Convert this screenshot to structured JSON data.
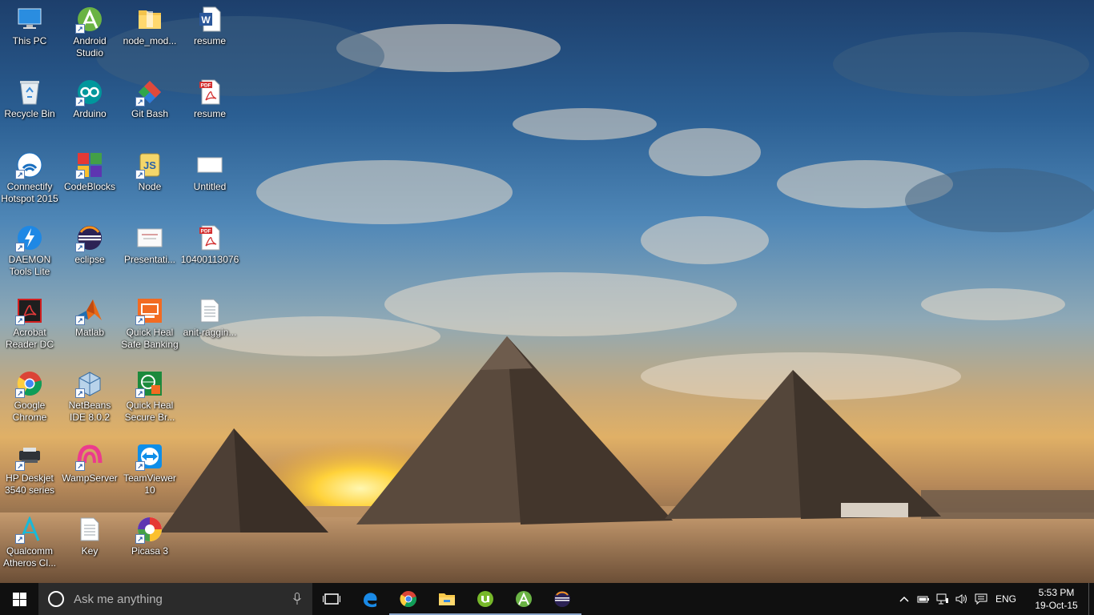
{
  "desktop": {
    "icons": [
      {
        "label": "This PC",
        "icon": "computer-icon",
        "shortcut": false
      },
      {
        "label": "Recycle Bin",
        "icon": "recycle-bin-icon",
        "shortcut": false
      },
      {
        "label": "Connectify Hotspot 2015",
        "icon": "connectify-icon",
        "shortcut": true
      },
      {
        "label": "DAEMON Tools Lite",
        "icon": "daemon-tools-icon",
        "shortcut": true
      },
      {
        "label": "Acrobat Reader DC",
        "icon": "acrobat-icon",
        "shortcut": true
      },
      {
        "label": "Google Chrome",
        "icon": "chrome-icon",
        "shortcut": true
      },
      {
        "label": "HP Deskjet 3540 series",
        "icon": "printer-icon",
        "shortcut": true
      },
      {
        "label": "Qualcomm Atheros Cl...",
        "icon": "qualcomm-icon",
        "shortcut": true
      },
      {
        "label": "Android Studio",
        "icon": "android-studio-icon",
        "shortcut": true
      },
      {
        "label": "Arduino",
        "icon": "arduino-icon",
        "shortcut": true
      },
      {
        "label": "CodeBlocks",
        "icon": "codeblocks-icon",
        "shortcut": true
      },
      {
        "label": "eclipse",
        "icon": "eclipse-icon",
        "shortcut": true
      },
      {
        "label": "Matlab",
        "icon": "matlab-icon",
        "shortcut": true
      },
      {
        "label": "NetBeans IDE 8.0.2",
        "icon": "netbeans-icon",
        "shortcut": true
      },
      {
        "label": "WampServer",
        "icon": "wampserver-icon",
        "shortcut": true
      },
      {
        "label": "Key",
        "icon": "text-file-icon",
        "shortcut": false
      },
      {
        "label": "node_mod...",
        "icon": "folder-icon",
        "shortcut": false
      },
      {
        "label": "Git Bash",
        "icon": "git-bash-icon",
        "shortcut": true
      },
      {
        "label": "Node",
        "icon": "nodejs-icon",
        "shortcut": true
      },
      {
        "label": "Presentati...",
        "icon": "presentation-icon",
        "shortcut": false
      },
      {
        "label": "Quick Heal Safe Banking",
        "icon": "quickheal-banking-icon",
        "shortcut": true
      },
      {
        "label": "Quick Heal Secure Br...",
        "icon": "quickheal-browser-icon",
        "shortcut": true
      },
      {
        "label": "TeamViewer 10",
        "icon": "teamviewer-icon",
        "shortcut": true
      },
      {
        "label": "Picasa 3",
        "icon": "picasa-icon",
        "shortcut": true
      },
      {
        "label": "resume",
        "icon": "word-doc-icon",
        "shortcut": false
      },
      {
        "label": "resume",
        "icon": "pdf-icon",
        "shortcut": false
      },
      {
        "label": "Untitled",
        "icon": "image-file-icon",
        "shortcut": false
      },
      {
        "label": "10400113076",
        "icon": "pdf-icon",
        "shortcut": false
      },
      {
        "label": "anit-raggin...",
        "icon": "text-file-icon",
        "shortcut": false
      }
    ]
  },
  "taskbar": {
    "search_placeholder": "Ask me anything",
    "pinned": [
      {
        "name": "task-view",
        "icon": "task-view-icon"
      },
      {
        "name": "edge",
        "icon": "edge-icon"
      },
      {
        "name": "chrome",
        "icon": "chrome-icon"
      },
      {
        "name": "file-explorer",
        "icon": "file-explorer-icon"
      },
      {
        "name": "utorrent",
        "icon": "utorrent-icon"
      },
      {
        "name": "android-studio",
        "icon": "android-studio-icon"
      },
      {
        "name": "eclipse",
        "icon": "eclipse-icon"
      }
    ],
    "tray": {
      "language": "ENG",
      "time": "5:53 PM",
      "date": "19-Oct-15"
    }
  },
  "colors": {
    "taskbar": "#101010",
    "search_box": "#2b2b2b",
    "active_indicator": "#8aa4c8"
  }
}
